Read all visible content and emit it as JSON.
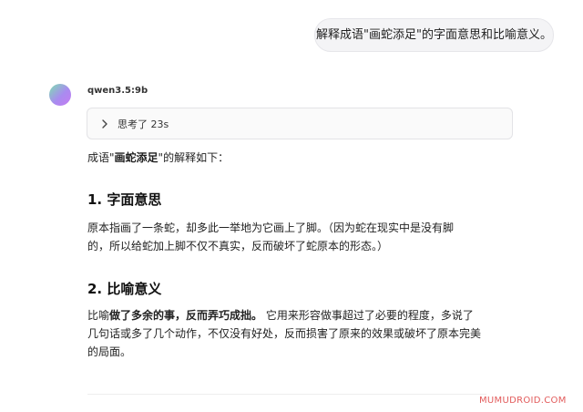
{
  "user_message": "解释成语\"画蛇添足\"的字面意思和比喻意义。",
  "assistant": {
    "model_name": "qwen3.5:9b",
    "thinking_label": "思考了 23s",
    "intro_pre": "成语\"",
    "intro_bold": "画蛇添足",
    "intro_post": "\"的解释如下：",
    "section1": {
      "heading": "1. 字面意思",
      "line1": "原本指画了一条蛇，却多此一举地为它画上了脚。（因为蛇在现实中是没有脚",
      "line2": "的，所以给蛇加上脚不仅不真实，反而破坏了蛇原本的形态。）"
    },
    "section2": {
      "heading": "2. 比喻意义",
      "line1_pre": "比喻",
      "line1_bold": "做了多余的事，反而弄巧成拙。",
      "line1_post": " 它用来形容做事超过了必要的程度，多说了",
      "line2": "几句话或多了几个动作，不仅没有好处，反而损害了原来的效果或破坏了原本完美",
      "line3": "的局面。"
    }
  },
  "watermark": "MUMUDROID.COM",
  "colors": {
    "bubble_bg": "#f4f4f6",
    "watermark": "#e25b5b"
  }
}
